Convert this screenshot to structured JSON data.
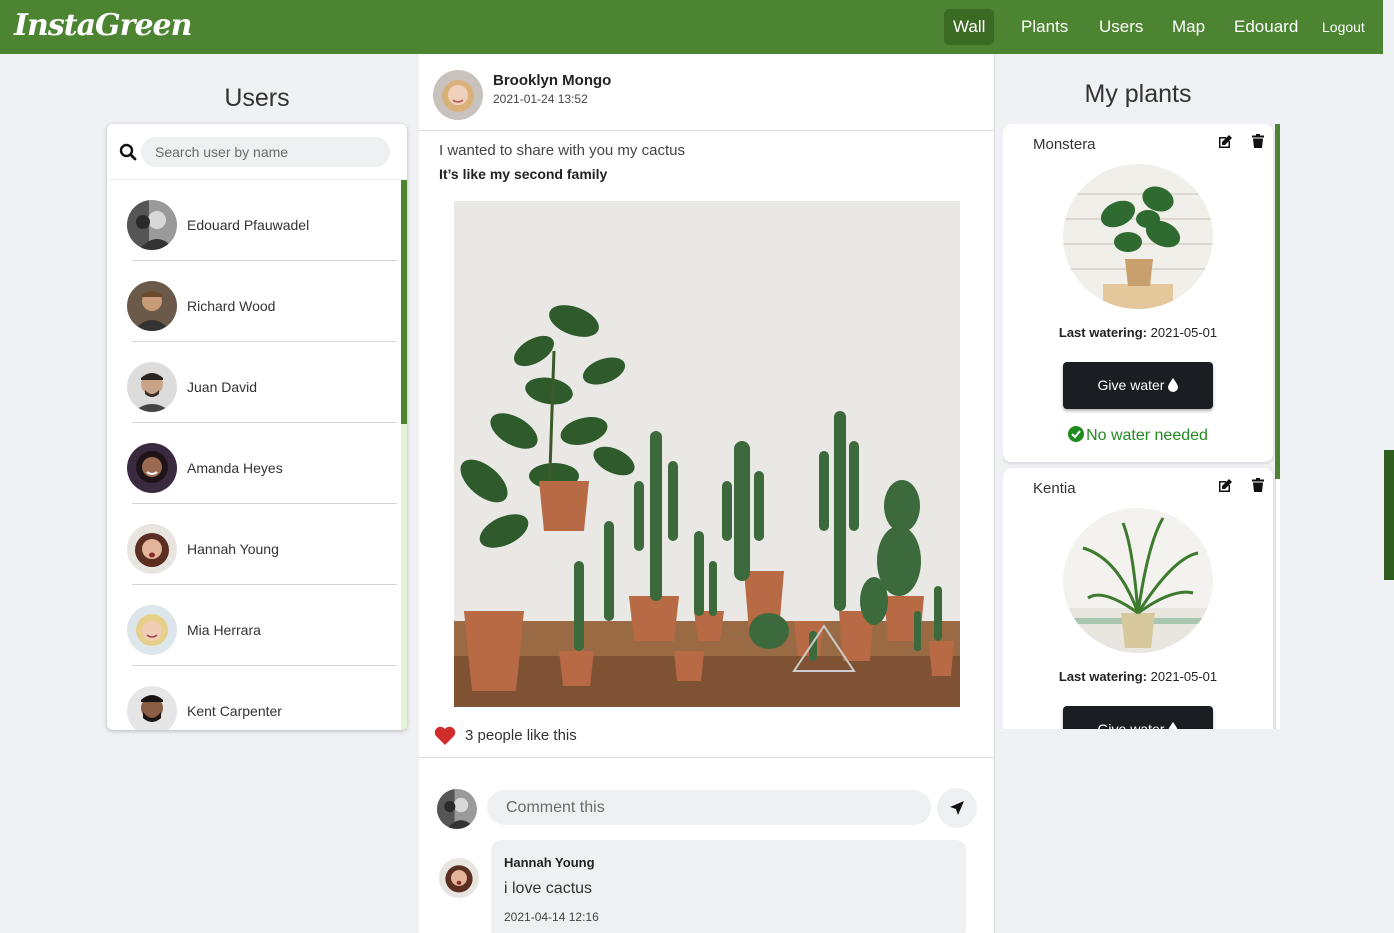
{
  "nav": {
    "logo": "InstaGreen",
    "items": [
      {
        "label": "Wall",
        "active": true
      },
      {
        "label": "Plants",
        "active": false
      },
      {
        "label": "Users",
        "active": false
      },
      {
        "label": "Map",
        "active": false
      },
      {
        "label": "Edouard",
        "active": false
      },
      {
        "label": "Logout",
        "active": false
      }
    ],
    "accent": "#4c8432"
  },
  "users_panel": {
    "title": "Users",
    "search_placeholder": "Search user by name",
    "users": [
      {
        "name": "Edouard Pfauwadel"
      },
      {
        "name": "Richard Wood"
      },
      {
        "name": "Juan David"
      },
      {
        "name": "Amanda Heyes"
      },
      {
        "name": "Hannah Young"
      },
      {
        "name": "Mia Herrara"
      },
      {
        "name": "Kent Carpenter"
      }
    ]
  },
  "post": {
    "author": "Brooklyn Mongo",
    "date": "2021-01-24 13:52",
    "text": "I wanted to share with you my cactus",
    "subtext": "It’s like my second family",
    "likes_text": "3 people like this",
    "comment_placeholder": "Comment this",
    "comments": [
      {
        "author": "Hannah Young",
        "text": "i love cactus",
        "date": "2021-04-14 12:16"
      }
    ]
  },
  "my_plants": {
    "title": "My plants",
    "plants": [
      {
        "name": "Monstera",
        "last_watering_label": "Last watering:",
        "last_watering": "2021-05-01",
        "button": "Give water",
        "status": "No water needed"
      },
      {
        "name": "Kentia",
        "last_watering_label": "Last watering:",
        "last_watering": "2021-05-01",
        "button": "Give water",
        "status": ""
      }
    ],
    "status_color": "#1f8a1f"
  }
}
